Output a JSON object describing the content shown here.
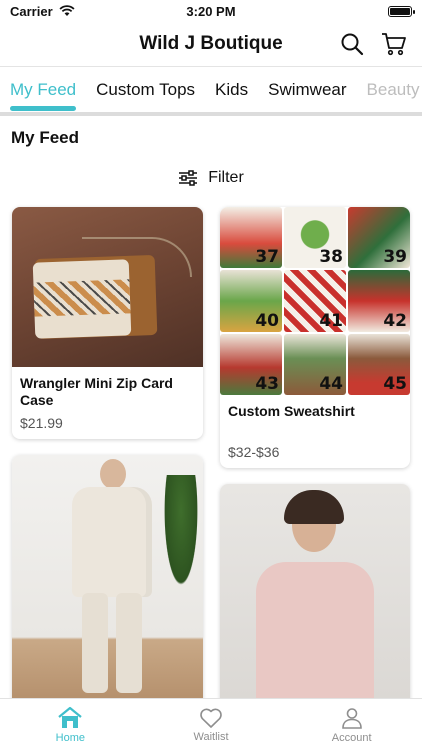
{
  "status_bar": {
    "carrier": "Carrier",
    "time": "3:20 PM"
  },
  "header": {
    "title": "Wild J Boutique"
  },
  "tabs": [
    {
      "label": "My Feed"
    },
    {
      "label": "Custom Tops"
    },
    {
      "label": "Kids"
    },
    {
      "label": "Swimwear"
    },
    {
      "label": "Beauty"
    }
  ],
  "feed": {
    "title": "My Feed",
    "filter_label": "Filter"
  },
  "products": [
    {
      "name": "Wrangler Mini Zip Card Case",
      "price": "$21.99"
    },
    {
      "name": "Custom Sweatshirt",
      "price": "$32-$36"
    }
  ],
  "sweatshirt_numbers": [
    "37",
    "38",
    "39",
    "40",
    "41",
    "42",
    "43",
    "44",
    "45"
  ],
  "bottom_nav": [
    {
      "label": "Home",
      "icon": "home-icon"
    },
    {
      "label": "Waitlist",
      "icon": "heart-icon"
    },
    {
      "label": "Account",
      "icon": "account-icon"
    }
  ],
  "colors": {
    "accent": "#3fbfcb"
  }
}
